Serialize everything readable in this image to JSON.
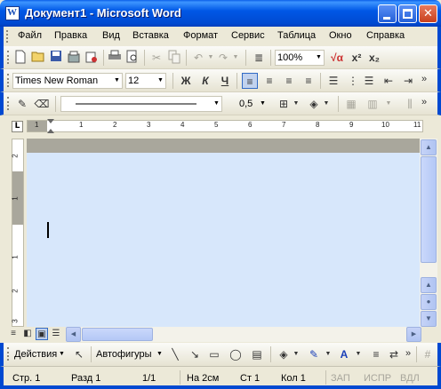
{
  "window": {
    "title": "Документ1 - Microsoft Word",
    "app_icon": "W",
    "minimize": "_",
    "maximize": "□",
    "close": "✕"
  },
  "menu": [
    "Файл",
    "Правка",
    "Вид",
    "Вставка",
    "Формат",
    "Сервис",
    "Таблица",
    "Окно",
    "Справка"
  ],
  "standard_toolbar": {
    "zoom": "100%",
    "icons": [
      "new-document-icon",
      "open-folder-icon",
      "save-icon",
      "permission-icon",
      "email-icon",
      "print-icon",
      "print-preview-icon",
      "cut-icon",
      "copy-icon",
      "undo-icon",
      "redo-icon",
      "columns-icon",
      "formula-icon",
      "superscript-icon",
      "subscript-icon"
    ],
    "formula_label": "√α",
    "superscript_label": "x²",
    "subscript_label": "x₂"
  },
  "formatting_toolbar": {
    "font": "Times New Roman",
    "size": "12",
    "bold": "Ж",
    "italic": "К",
    "underline": "Ч"
  },
  "drawing_line_toolbar": {
    "line_weight": "0,5"
  },
  "ruler": {
    "numbers": [
      "1",
      "1",
      "2",
      "3",
      "4",
      "5",
      "6",
      "7",
      "8",
      "9",
      "10",
      "11"
    ]
  },
  "vertical_ruler": {
    "numbers": [
      "2",
      "1",
      "1",
      "2",
      "3"
    ]
  },
  "drawing_toolbar": {
    "actions": "Действия",
    "autoshapes": "Автофигуры",
    "text_color_label": "A"
  },
  "status_bar": {
    "page": "Стр. 1",
    "section": "Разд 1",
    "pages": "1/1",
    "position": "На 2см",
    "line": "Ст 1",
    "column": "Кол 1",
    "rec": "ЗАП",
    "trk": "ИСПР",
    "ext": "ВДЛ"
  }
}
